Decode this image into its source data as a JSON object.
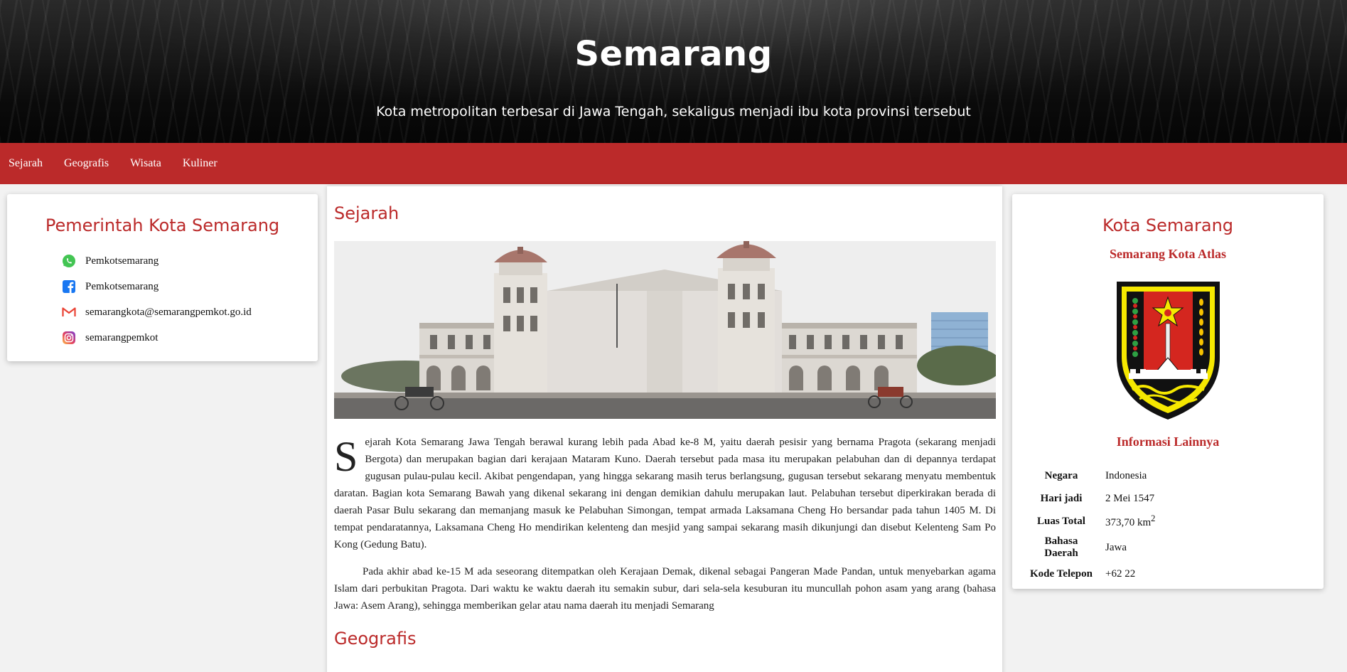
{
  "header": {
    "title": "Semarang",
    "subtitle": "Kota metropolitan terbesar di Jawa Tengah, sekaligus menjadi ibu kota provinsi tersebut"
  },
  "nav": {
    "items": [
      {
        "label": "Sejarah"
      },
      {
        "label": "Geografis"
      },
      {
        "label": "Wisata"
      },
      {
        "label": "Kuliner"
      }
    ]
  },
  "left": {
    "heading": "Pemerintah Kota Semarang",
    "contacts": [
      {
        "icon": "whatsapp-icon",
        "text": "Pemkotsemarang"
      },
      {
        "icon": "facebook-icon",
        "text": "Pemkotsemarang"
      },
      {
        "icon": "gmail-icon",
        "text": "semarangkota@semarangpemkot.go.id"
      },
      {
        "icon": "instagram-icon",
        "text": "semarangpemkot"
      }
    ]
  },
  "main": {
    "sejarah_title": "Sejarah",
    "dropcap": "S",
    "para1": "ejarah Kota Semarang Jawa Tengah berawal kurang lebih pada Abad ke-8 M, yaitu daerah pesisir yang bernama Pragota (sekarang menjadi Bergota) dan merupakan bagian dari kerajaan Mataram Kuno. Daerah tersebut pada masa itu merupakan pelabuhan dan di depannya terdapat gugusan pulau-pulau kecil. Akibat pengendapan, yang hingga sekarang masih terus berlangsung, gugusan tersebut sekarang menyatu membentuk daratan. Bagian kota Semarang Bawah yang dikenal sekarang ini dengan demikian dahulu merupakan laut. Pelabuhan tersebut diperkirakan berada di daerah Pasar Bulu sekarang dan memanjang masuk ke Pelabuhan Simongan, tempat armada Laksamana Cheng Ho bersandar pada tahun 1405 M. Di tempat pendaratannya, Laksamana Cheng Ho mendirikan kelenteng dan mesjid yang sampai sekarang masih dikunjungi dan disebut Kelenteng Sam Po Kong (Gedung Batu).",
    "para2": "Pada akhir abad ke-15 M ada seseorang ditempatkan oleh Kerajaan Demak, dikenal sebagai Pangeran Made Pandan, untuk menyebarkan agama Islam dari perbukitan Pragota. Dari waktu ke waktu daerah itu semakin subur, dari sela-sela kesuburan itu muncullah pohon asam yang arang (bahasa Jawa: Asem Arang), sehingga memberikan gelar atau nama daerah itu menjadi Semarang",
    "geografis_title": "Geografis"
  },
  "right": {
    "heading": "Kota Semarang",
    "motto": "Semarang Kota Atlas",
    "info_heading": "Informasi Lainnya",
    "info": [
      {
        "key": "Negara",
        "value": "Indonesia"
      },
      {
        "key": "Hari jadi",
        "value": "2 Mei 1547"
      },
      {
        "key": "Luas Total",
        "value": "373,70 km",
        "sup": "2"
      },
      {
        "key": "Bahasa Daerah",
        "value": "Jawa"
      },
      {
        "key": "Kode Telepon",
        "value": "+62 22"
      }
    ]
  },
  "colors": {
    "accent": "#bb2a2a",
    "header_bg": "#0b0b0b"
  }
}
